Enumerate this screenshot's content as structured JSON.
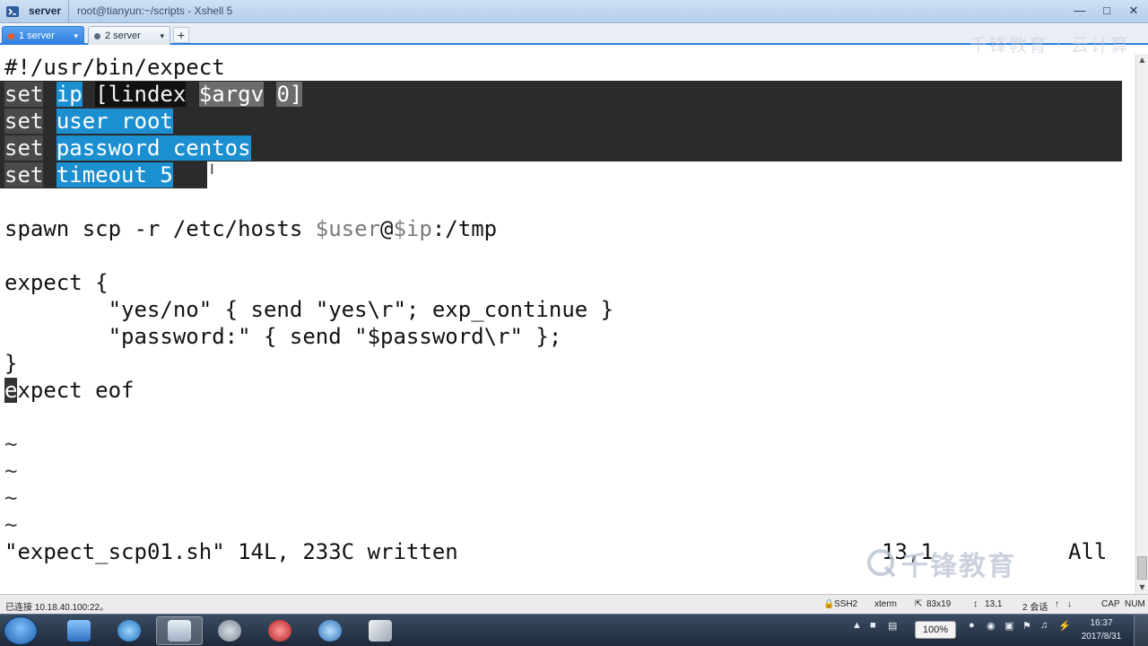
{
  "titlebar": {
    "session_name": "server",
    "title": "root@tianyun:~/scripts - Xshell 5"
  },
  "tabs": [
    {
      "label": "1 server",
      "active": true
    },
    {
      "label": "2 server",
      "active": false
    }
  ],
  "tab_add_label": "+",
  "watermark_top": "千锋教育 · 云计算",
  "watermark_bottom": "千锋教育",
  "terminal": {
    "line1": "#!/usr/bin/expect",
    "set_kw": "set",
    "l2_var": "ip",
    "l2_cmd": "[lindex",
    "l2_argv": "$argv",
    "l2_idx": "0]",
    "l3_var": "user",
    "l3_val": "root",
    "l4_var": "password",
    "l4_val": "centos",
    "l5_var": "timeout",
    "l5_val": "5",
    "spawn_cmd": "spawn scp -r /etc/hosts ",
    "spawn_user": "$user",
    "spawn_at": "@",
    "spawn_ip": "$ip",
    "spawn_dest": ":/tmp",
    "expect_open": "expect {",
    "yesno_line": "        \"yes/no\" { send \"yes\\r\"; exp_continue }",
    "password_line": "        \"password:\" { send \"$password\\r\" };",
    "close_brace": "}",
    "eof_cursor_char": "e",
    "eof_rest": "xpect eof",
    "tilde": "~",
    "status_message": "\"expect_scp01.sh\" 14L, 233C written",
    "cursor_pos": "13,1",
    "scroll_pos": "All"
  },
  "statusbar": {
    "connection": "已连接 10.18.40.100:22。",
    "protocol": "SSH2",
    "terminal_type": "xterm",
    "size": "83x19",
    "position": "13,1",
    "sessions": "2 会话",
    "caps": "CAP",
    "num": "NUM"
  },
  "taskbar": {
    "zoom": "100%",
    "time": "16:37",
    "date": "2017/8/31"
  },
  "colors": {
    "selection_bg": "#2b2b2b",
    "selection_blue": "#1c8fd0",
    "tab_active": "#2b7de0"
  }
}
